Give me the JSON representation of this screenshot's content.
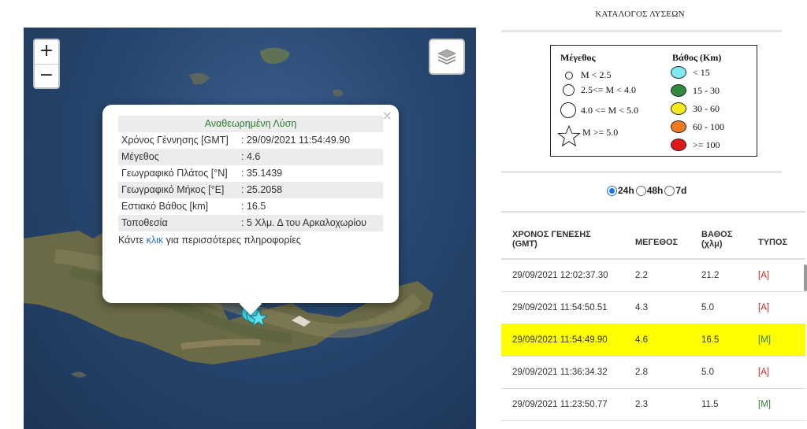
{
  "map": {
    "zoom_in_label": "+",
    "zoom_out_label": "−",
    "layers_icon": "layers-icon",
    "marker_icon": "star-marker-icon",
    "marker_color": "#3fd3e6"
  },
  "popup": {
    "close_label": "×",
    "header": "Αναθεωρημένη Λύση",
    "rows": [
      {
        "key": "Χρόνος Γέννησης [GMT]",
        "value": ": 29/09/2021 11:54:49.90"
      },
      {
        "key": "Μέγεθος",
        "value": ": 4.6"
      },
      {
        "key": "Γεωγραφικό Πλάτος [°N]",
        "value": ": 35.1439"
      },
      {
        "key": "Γεωγραφικό Μήκος [°E]",
        "value": ": 25.2058"
      },
      {
        "key": "Εστιακό Βάθος [km]",
        "value": ": 16.5"
      },
      {
        "key": "Τοποθεσία",
        "value": ": 5 Χλμ. Δ του Αρκαλοχωρίου"
      }
    ],
    "more_prefix": "Κάντε ",
    "more_link": "κλικ",
    "more_suffix": " για περισσότερες πληροφορίες"
  },
  "panel": {
    "title": "ΚΑΤΑΛΟΓΟΣ ΛΥΣΕΩΝ",
    "legend": {
      "magnitude_title": "Μέγεθος",
      "depth_title": "Βάθος (Km)",
      "magnitude_items": [
        "M < 2.5",
        "2.5<= M < 4.0",
        "4.0 <= M < 5.0",
        "M >= 5.0"
      ],
      "depth_items": [
        {
          "label": "< 15",
          "color": "#7fe8f0"
        },
        {
          "label": "15 - 30",
          "color": "#2e8b3e"
        },
        {
          "label": "30 - 60",
          "color": "#f2ea1f"
        },
        {
          "label": "60 - 100",
          "color": "#f07a1e"
        },
        {
          "label": ">= 100",
          "color": "#e0191b"
        }
      ]
    },
    "periods": [
      "24h",
      "48h",
      "7d"
    ],
    "selected_period": "24h",
    "table": {
      "headers": {
        "origin_time": "ΧΡΟΝΟΣ ΓΕΝΕΣΗΣ (GMT)",
        "magnitude": "ΜΕΓΕΘΟΣ",
        "depth": "ΒΑΘΟΣ (χλμ)",
        "type": "ΤΥΠΟΣ"
      },
      "rows": [
        {
          "time": "29/09/2021 12:02:37.30",
          "mag": "2.2",
          "depth": "21.2",
          "type": "[A]"
        },
        {
          "time": "29/09/2021 11:54:50.51",
          "mag": "4.3",
          "depth": "5.0",
          "type": "[A]"
        },
        {
          "time": "29/09/2021 11:54:49.90",
          "mag": "4.6",
          "depth": "16.5",
          "type": "[M]"
        },
        {
          "time": "29/09/2021 11:36:34.32",
          "mag": "2.8",
          "depth": "5.0",
          "type": "[A]"
        },
        {
          "time": "29/09/2021 11:23:50.77",
          "mag": "2.3",
          "depth": "11.5",
          "type": "[M]"
        }
      ],
      "highlight_color": "#ffff00"
    }
  }
}
